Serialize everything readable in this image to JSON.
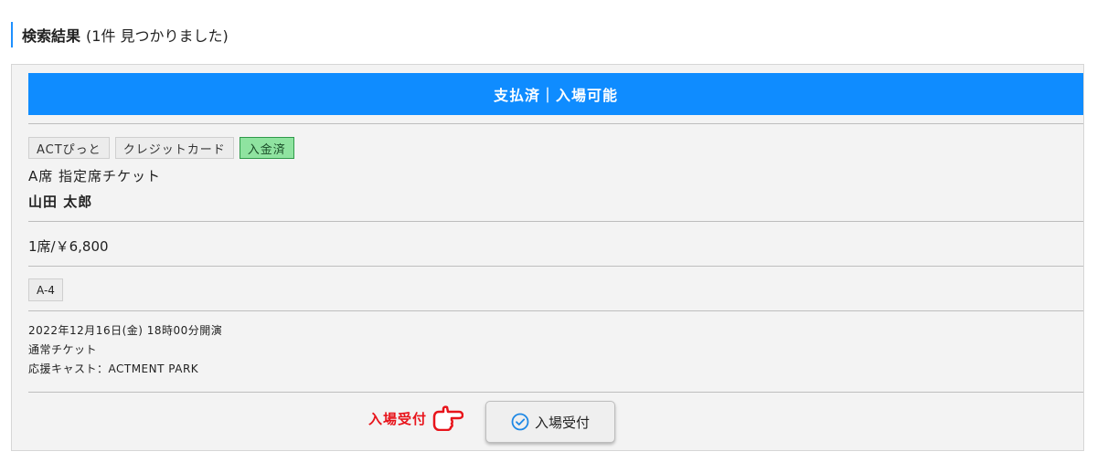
{
  "heading": {
    "title": "検索結果",
    "count_text": "(1件 見つかりました)"
  },
  "ticket": {
    "status": "支払済｜入場可能",
    "tags": [
      "ACTぴっと",
      "クレジットカード",
      "入金済"
    ],
    "ticket_name": "A席 指定席チケット",
    "holder_name": "山田 太郎",
    "price": "1席/￥6,800",
    "seat": "A-4",
    "event_date": "2022年12月16日(金) 18時00分開演",
    "ticket_type": "通常チケット",
    "support_cast": "応援キャスト：ACTMENT PARK"
  },
  "annotation": {
    "label": "入場受付"
  },
  "entry_button": {
    "label": "入場受付"
  },
  "colors": {
    "status_bar": "#0f8cff",
    "paid_tag_bg": "#8fe3a0",
    "annotation_red": "#e8141b",
    "check_icon": "#1e88e5"
  },
  "icons": {
    "pointer": "pointing-hand-icon",
    "check": "check-circle-icon"
  }
}
